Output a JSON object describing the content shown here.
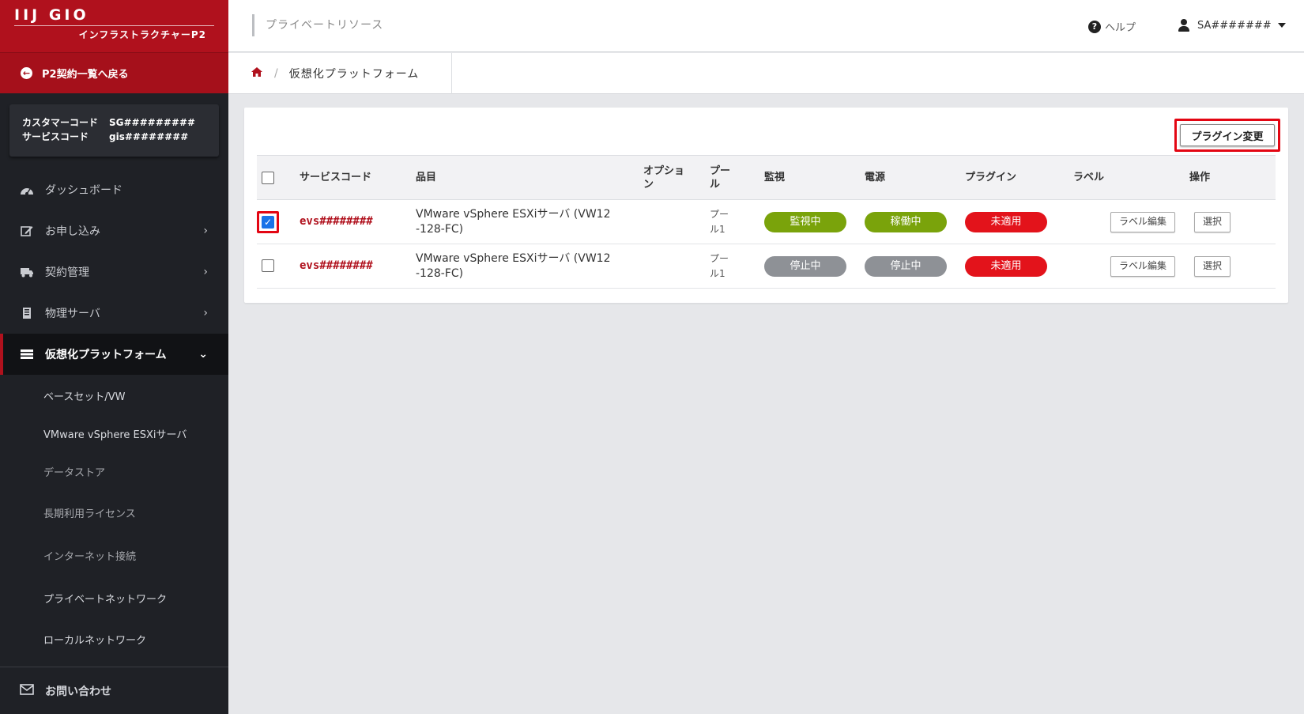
{
  "brand": {
    "logo": "IIJ GIO",
    "subtitle": "インフラストラクチャーP2"
  },
  "sidebar": {
    "back_label": "P2契約一覧へ戻る",
    "codes": {
      "customer_label": "カスタマーコード",
      "customer_value": "SG#########",
      "service_label": "サービスコード",
      "service_value": "gis########"
    },
    "items": [
      {
        "label": "ダッシュボード",
        "icon": "dashboard-icon"
      },
      {
        "label": "お申し込み",
        "icon": "edit-icon"
      },
      {
        "label": "契約管理",
        "icon": "truck-icon"
      },
      {
        "label": "物理サーバ",
        "icon": "server-icon"
      },
      {
        "label": "仮想化プラットフォーム",
        "icon": "list-icon"
      }
    ],
    "subitems": [
      "ベースセット/VW",
      "VMware vSphere ESXiサーバ",
      "データストア",
      "長期利用ライセンス",
      "インターネット接続",
      "プライベートネットワーク",
      "ローカルネットワーク"
    ],
    "contact_label": "お問い合わせ"
  },
  "header": {
    "title": "プライベートリソース",
    "help": "ヘルプ",
    "user": "SA#######"
  },
  "breadcrumb": {
    "current": "仮想化プラットフォーム"
  },
  "toolbar": {
    "plugin_change": "プラグイン変更"
  },
  "table": {
    "headers": {
      "service_code": "サービスコード",
      "item": "品目",
      "option_1": "オプショ",
      "option_2": "ン",
      "pool_1": "プー",
      "pool_2": "ル",
      "monitor": "監視",
      "power": "電源",
      "plugin": "プラグイン",
      "label": "ラベル",
      "operation": "操作"
    },
    "rows": [
      {
        "checked": true,
        "service_code": "evs########",
        "item_line1": "VMware vSphere ESXiサーバ (VW12",
        "item_line2": "-128-FC)",
        "pool_line1": "プー",
        "pool_line2": "ル1",
        "monitor": "監視中",
        "power": "稼働中",
        "plugin": "未適用",
        "label_btn": "ラベル編集",
        "select_btn": "選択"
      },
      {
        "checked": false,
        "service_code": "evs########",
        "item_line1": "VMware vSphere ESXiサーバ (VW12",
        "item_line2": "-128-FC)",
        "pool_line1": "プー",
        "pool_line2": "ル1",
        "monitor": "停止中",
        "power": "停止中",
        "plugin": "未適用",
        "label_btn": "ラベル編集",
        "select_btn": "選択"
      }
    ]
  },
  "colors": {
    "brand_red": "#b0111d",
    "highlight_red": "#e30613",
    "status_green": "#7aa30b",
    "status_gray": "#8e9196",
    "status_red": "#e3131b"
  }
}
